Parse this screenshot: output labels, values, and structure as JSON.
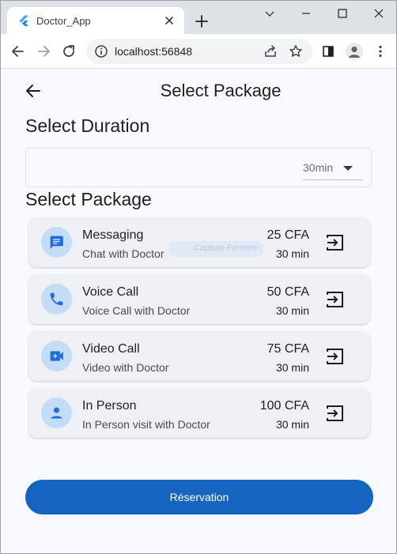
{
  "browser": {
    "tab_title": "Doctor_App",
    "url": "localhost:56848",
    "colors": {
      "tabstrip": "#dee1e6",
      "toolbar": "#ffffff",
      "omnibox": "#f1f3f4"
    },
    "icons": [
      "flutter-favicon-icon",
      "close-icon",
      "plus-icon",
      "minimize-icon",
      "maximize-icon",
      "close-window-icon",
      "back-icon",
      "forward-icon",
      "reload-icon",
      "info-icon",
      "share-icon",
      "star-icon",
      "side-panel-icon",
      "profile-icon",
      "more-vert-icon"
    ]
  },
  "app": {
    "title": "Select Package",
    "duration_heading": "Select Duration",
    "duration_value": "30min",
    "package_heading": "Select Package",
    "overlay_text": "Capture Fenêtre",
    "reserve_label": "Réservation",
    "colors": {
      "accent": "#1565c0",
      "icon_bg": "#c5dcf7",
      "icon_fg": "#1e6ed8",
      "card_bg": "#eef0f5",
      "page_bg": "#f8f9fc"
    },
    "packages": [
      {
        "name": "Messaging",
        "description": "Chat with Doctor",
        "price": "25 CFA",
        "duration": "30 min",
        "icon": "message-icon"
      },
      {
        "name": "Voice Call",
        "description": "Voice Call with Doctor",
        "price": "50 CFA",
        "duration": "30 min",
        "icon": "phone-icon"
      },
      {
        "name": "Video Call",
        "description": "Video with Doctor",
        "price": "75 CFA",
        "duration": "30 min",
        "icon": "video-call-icon"
      },
      {
        "name": "In Person",
        "description": "In Person visit with Doctor",
        "price": "100 CFA",
        "duration": "30 min",
        "icon": "person-icon"
      }
    ]
  }
}
